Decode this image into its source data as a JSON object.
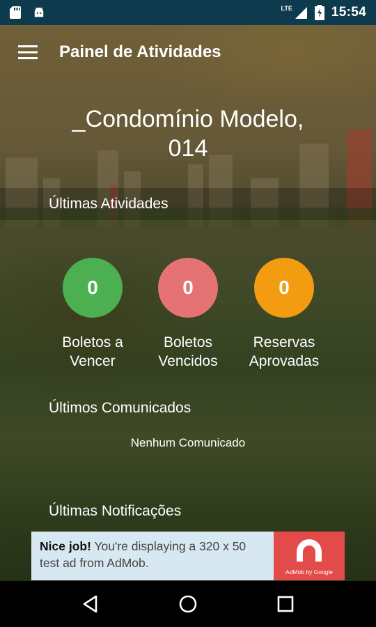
{
  "status_bar": {
    "network": "LTE",
    "time": "15:54"
  },
  "app_bar": {
    "title": "Painel de Atividades"
  },
  "condominium": {
    "name_line1": "_Condomínio Modelo,",
    "name_line2": "014"
  },
  "sections": {
    "activities_title": "Últimas Atividades",
    "announcements_title": "Últimos Comunicados",
    "announcements_empty": "Nenhum Comunicado",
    "notifications_title": "Últimas Notificações"
  },
  "activities": [
    {
      "count": "0",
      "label_line1": "Boletos a",
      "label_line2": "Vencer",
      "color": "#4caf50"
    },
    {
      "count": "0",
      "label_line1": "Boletos",
      "label_line2": "Vencidos",
      "color": "#e57373"
    },
    {
      "count": "0",
      "label_line1": "Reservas",
      "label_line2": "Aprovadas",
      "color": "#f39c12"
    }
  ],
  "ad": {
    "headline": "Nice job!",
    "body": "You're displaying a 320 x 50 test ad from AdMob.",
    "logo_caption": "AdMob by Google"
  }
}
